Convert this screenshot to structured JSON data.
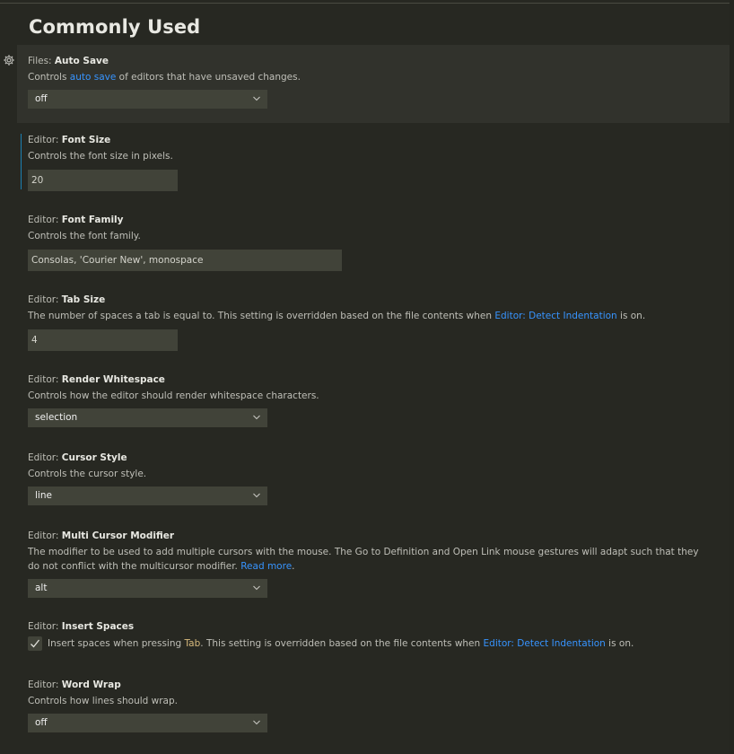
{
  "section": {
    "title": "Commonly Used"
  },
  "settings": [
    {
      "category": "Files: ",
      "name": "Auto Save",
      "desc_pre": "Controls ",
      "desc_link": "auto save",
      "desc_post": " of editors that have unsaved changes.",
      "type": "select",
      "value": "off"
    },
    {
      "category": "Editor: ",
      "name": "Font Size",
      "desc": "Controls the font size in pixels.",
      "type": "number",
      "value": "20"
    },
    {
      "category": "Editor: ",
      "name": "Font Family",
      "desc": "Controls the font family.",
      "type": "text",
      "value": "Consolas, 'Courier New', monospace"
    },
    {
      "category": "Editor: ",
      "name": "Tab Size",
      "desc_pre": "The number of spaces a tab is equal to. This setting is overridden based on the file contents when ",
      "desc_link": "Editor: Detect Indentation",
      "desc_post": " is on.",
      "type": "number",
      "value": "4"
    },
    {
      "category": "Editor: ",
      "name": "Render Whitespace",
      "desc": "Controls how the editor should render whitespace characters.",
      "type": "select",
      "value": "selection"
    },
    {
      "category": "Editor: ",
      "name": "Cursor Style",
      "desc": "Controls the cursor style.",
      "type": "select",
      "value": "line"
    },
    {
      "category": "Editor: ",
      "name": "Multi Cursor Modifier",
      "desc_pre": "The modifier to be used to add multiple cursors with the mouse. The Go to Definition and Open Link mouse gestures will adapt such that they do not conflict with the multicursor modifier. ",
      "desc_link": "Read more",
      "desc_post": ".",
      "type": "select",
      "value": "alt"
    },
    {
      "category": "Editor: ",
      "name": "Insert Spaces",
      "check_pre": "Insert spaces when pressing ",
      "check_code": "Tab",
      "check_mid": ". This setting is overridden based on the file contents when ",
      "check_link": "Editor: Detect Indentation",
      "check_post": " is on.",
      "type": "checkbox",
      "checked": true
    },
    {
      "category": "Editor: ",
      "name": "Word Wrap",
      "desc": "Controls how lines should wrap.",
      "type": "select",
      "value": "off"
    }
  ],
  "icons": {
    "gear": "gear-icon",
    "chevron": "chevron-down-icon",
    "check": "check-icon"
  },
  "colors": {
    "background": "#272822",
    "control_bg": "#414339",
    "link": "#3794ff",
    "focus_border": "#1b80b2",
    "code": "#d7ba7d"
  }
}
